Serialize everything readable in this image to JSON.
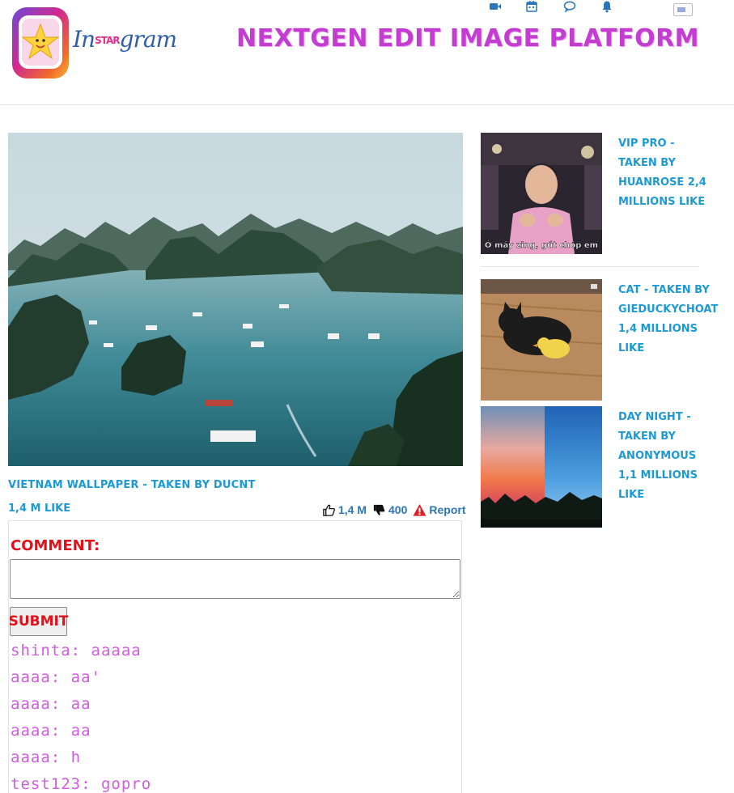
{
  "header": {
    "logo_text": "In",
    "logo_star": "STAR",
    "logo_tail": "gram",
    "site_title": "NEXTGEN EDIT IMAGE PLATFORM",
    "icons": [
      "video-camera-icon",
      "calendar-icon",
      "chat-bubble-icon",
      "bell-icon"
    ]
  },
  "main_post": {
    "caption": "VIETNAM WALLPAPER - TAKEN BY DUCNT",
    "like_count": "1,4 M LIKE",
    "likes": "1,4 M",
    "dislikes": "400",
    "report": "Report"
  },
  "comment_form": {
    "label": "COMMENT:",
    "submit_label": "SUBMIT",
    "input_value": ""
  },
  "comments": [
    {
      "text": "shinta: aaaaa"
    },
    {
      "text": "aaaa: aa'"
    },
    {
      "text": "aaaa: aa"
    },
    {
      "text": "aaaa: aa"
    },
    {
      "text": "aaaa: h"
    },
    {
      "text": "test123: gopro"
    }
  ],
  "sidebar": {
    "items": [
      {
        "text": "VIP PRO - TAKEN BY HUANROSE 2,4 MILLIONS LIKE",
        "subtitle_overlay": "Ở mây zing, gút chóp em"
      },
      {
        "text": "CAT - TAKEN BY GIEDUCKYCHOAT 1,4 MILLIONS LIKE"
      },
      {
        "text": "DAY NIGHT - TAKEN BY ANONYMOUS 1,1 MILLIONS LIKE"
      }
    ]
  },
  "colors": {
    "title": "#c33ed0",
    "link_blue": "#1c9ad6",
    "comment_red": "#e3101a",
    "comment_pink": "#d05ce0",
    "report_red": "#d9242b"
  }
}
